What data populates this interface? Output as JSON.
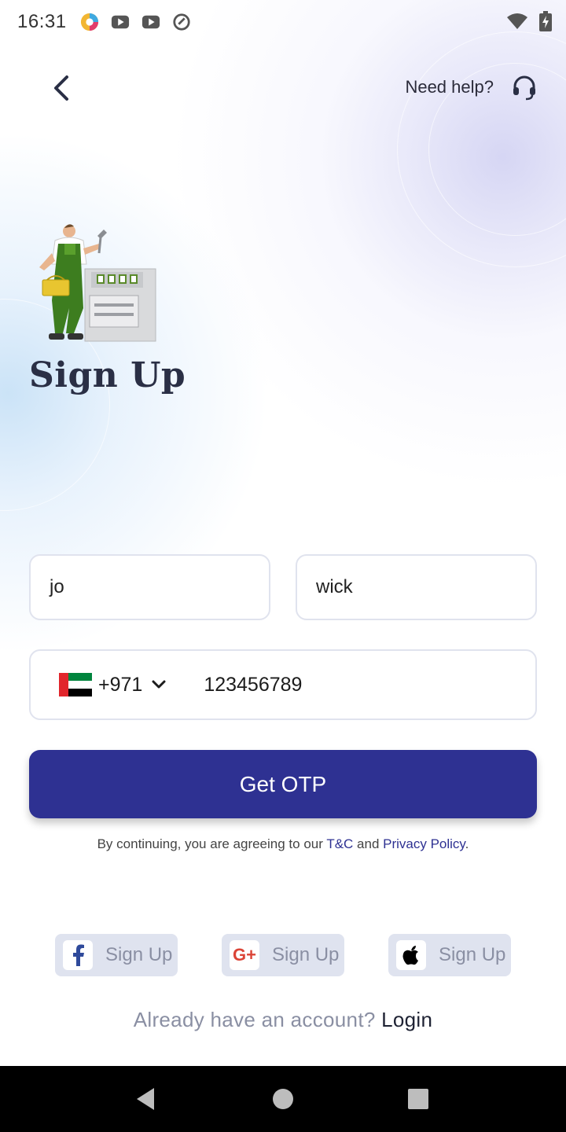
{
  "status_bar": {
    "time": "16:31",
    "app_icons": [
      "circle-app-icon",
      "youtube-icon",
      "youtube-icon",
      "at-sign-icon"
    ],
    "right_icons": [
      "wifi-icon",
      "battery-charging-icon"
    ]
  },
  "header": {
    "back_icon": "chevron-left-icon",
    "help_label": "Need help?",
    "help_icon": "headset-icon"
  },
  "page": {
    "title": "Sign Up"
  },
  "form": {
    "first_name_value": "jo",
    "last_name_value": "wick",
    "country_code": "+971",
    "phone_value": "123456789",
    "country_flag": "uae-flag"
  },
  "otp_button_label": "Get OTP",
  "terms": {
    "prefix": "By continuing, you are agreeing to our ",
    "tc_link": "T&C",
    "and": " and ",
    "privacy_link": "Privacy Policy",
    "suffix": "."
  },
  "social": [
    {
      "icon": "facebook-icon",
      "label": "Sign Up"
    },
    {
      "icon": "google-plus-icon",
      "label": "Sign Up"
    },
    {
      "icon": "apple-icon",
      "label": "Sign Up"
    }
  ],
  "login": {
    "prompt": "Already have an account? ",
    "link": "Login"
  },
  "colors": {
    "primary": "#2e3192",
    "title": "#2a2f45",
    "muted": "#8a8fa3",
    "social_bg": "#dfe3ef"
  }
}
